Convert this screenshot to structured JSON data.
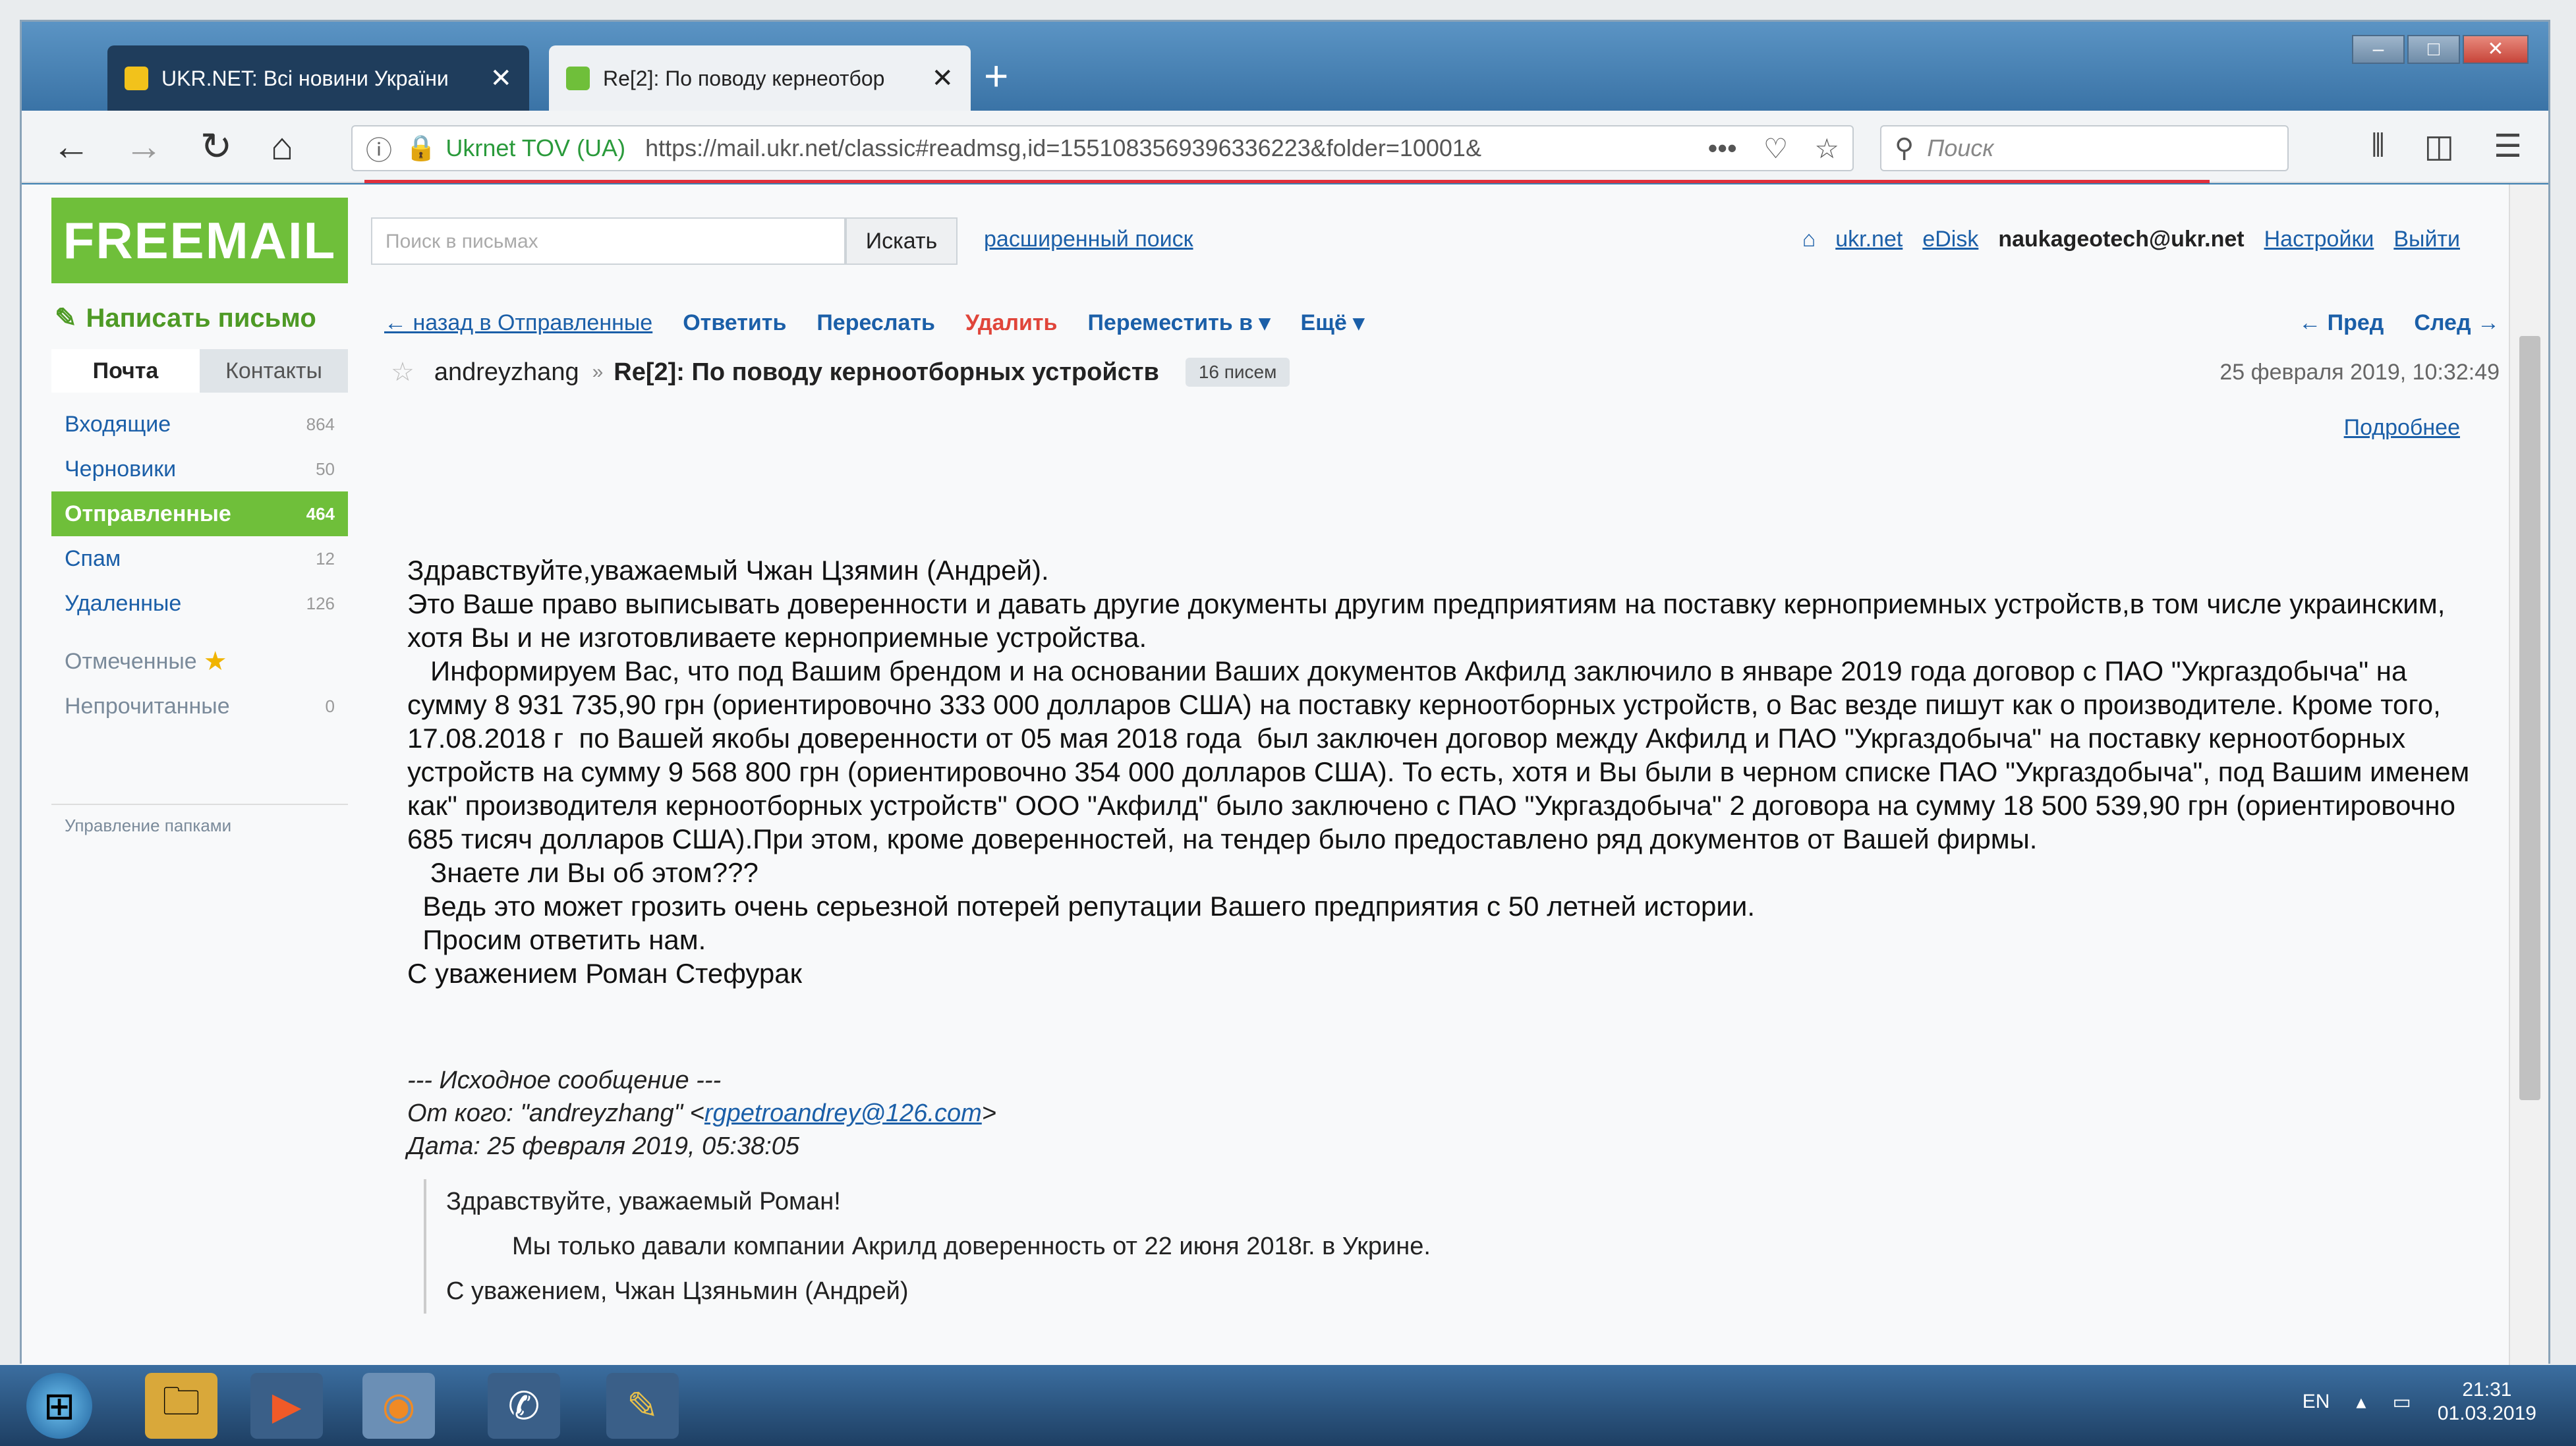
{
  "browser": {
    "tab_inactive": "UKR.NET: Всі новини України",
    "tab_active": "Re[2]: По поводу кернеотбор",
    "cert": "Ukrnet TOV (UA)",
    "url": "https://mail.ukr.net/classic#readmsg,id=1551083569396336223&folder=10001&",
    "search_placeholder": "Поиск"
  },
  "mail": {
    "logo": "FREEMAIL",
    "search_placeholder": "Поиск в письмах",
    "search_button": "Искать",
    "adv_search": "расширенный поиск",
    "top_links": [
      "ukr.net",
      "eDisk"
    ],
    "user": "naukageotech@ukr.net",
    "settings": "Настройки",
    "logout": "Выйти",
    "compose": "Написать письмо",
    "tab_mail": "Почта",
    "tab_contacts": "Контакты",
    "folders": [
      {
        "name": "Входящие",
        "count": "864"
      },
      {
        "name": "Черновики",
        "count": "50"
      },
      {
        "name": "Отправленные",
        "count": "464"
      },
      {
        "name": "Спам",
        "count": "12"
      },
      {
        "name": "Удаленные",
        "count": "126"
      },
      {
        "name": "Отмеченные",
        "count": ""
      },
      {
        "name": "Непрочитанные",
        "count": "0"
      }
    ],
    "manage_folders": "Управление папками",
    "toolbar": {
      "back": "← назад в Отправленные",
      "reply": "Ответить",
      "forward": "Переслать",
      "delete": "Удалить",
      "move": "Переместить в ▾",
      "more": "Ещё ▾",
      "prev": "← Пред",
      "next": "След →"
    },
    "message": {
      "from": "andreyzhang",
      "subject": "Re[2]: По поводу керноотборных устройств",
      "count_badge": "16 писем",
      "date": "25 февраля 2019, 10:32:49",
      "details": "Подробнее",
      "body": "Здравствуйте,уважаемый Чжан Цзямин (Андрей).\nЭто Ваше право выписывать доверенности и давать другие документы другим предприятиям на поставку кернoприемных устройств,в том числе украинским, хотя Вы и не изготовливаете кернoприемные устройства.\n   Информируем Вас, что под Вашим брендом и на основании Ваших документов Акфилд заключило в январе 2019 года договор с ПАО \"Укргаздобыча\" на сумму 8 931 735,90 грн (ориентировочно 333 000 долларов США) на поставку керноотборных устройств, о Вас везде пишут как о производителе. Кроме того, 17.08.2018 г  по Вашей якобы доверенности от 05 мая 2018 года  был заключен договор между Акфилд и ПАО \"Укргаздобыча\" на поставку керноотборных устройств на сумму 9 568 800 грн (ориентировочно 354 000 долларов США). То есть, хотя и Вы были в черном списке ПАО \"Укргаздобыча\", под Вашим именем как\" производителя керноотборных устройств\" ООО \"Акфилд\" было заключено с ПАО \"Укргаздобыча\" 2 договора на сумму 18 500 539,90 грн (ориентировочно 685 тисяч долларов США).При этом, кроме доверенностей, на тендер было предоставлено ряд документов от Вашей фирмы.\n   Знаете ли Вы об этом???\n  Ведь это может грозить очень серьезной потерей репутации Вашего предприятия с 50 летней истории.\n  Просим ответить нам.\nС уважением Роман Стефурак",
      "orig_header": "--- Исходное сообщение ---",
      "orig_from_prefix": "От кого: \"andreyzhang\" <",
      "orig_email": "rgpetroandrey@126.com",
      "orig_from_suffix": ">",
      "orig_date": "Дата: 25 февраля 2019, 05:38:05",
      "quote_greeting": "Здравствуйте, уважаемый Роман!",
      "quote_body": "Мы только давали компании Акрилд доверенность от 22 июня 2018г. в Укрине.",
      "quote_sign": "С уважением, Чжан Цзяньмин (Андрей)"
    }
  },
  "taskbar": {
    "lang": "EN",
    "time": "21:31",
    "date": "01.03.2019"
  },
  "colors": {
    "brand": "#6fbf3a",
    "link": "#1b5fa8",
    "accent_red": "#e0303c"
  }
}
